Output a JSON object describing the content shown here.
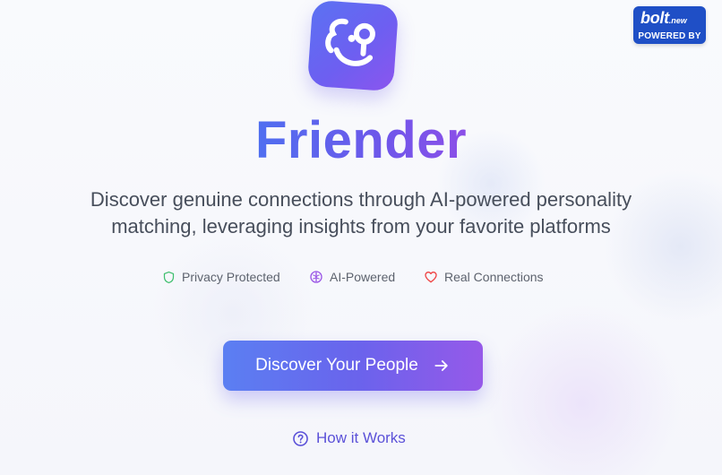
{
  "app": {
    "name": "Friender",
    "logo_icon": "smiley-face-logo-icon"
  },
  "hero": {
    "subtitle_line1": "Discover genuine connections through AI-powered personality",
    "subtitle_line2": "matching, leveraging insights from your favorite platforms"
  },
  "features": [
    {
      "label": "Privacy Protected",
      "icon": "shield-icon",
      "color": "#3fbf6e"
    },
    {
      "label": "AI-Powered",
      "icon": "brain-icon",
      "color": "#9a55e6"
    },
    {
      "label": "Real Connections",
      "icon": "heart-icon",
      "color": "#ef4444"
    }
  ],
  "cta": {
    "label": "Discover Your People",
    "icon": "arrow-right-icon"
  },
  "secondary_link": {
    "label": "How it Works",
    "icon": "help-circle-icon"
  },
  "powered_badge": {
    "brand": "bolt",
    "brand_suffix": ".new",
    "caption": "POWERED BY"
  },
  "colors": {
    "accent_blue": "#4f6ff0",
    "accent_purple": "#8c4fe8",
    "badge_bg": "#1f4fc6",
    "text_muted": "#474e5b"
  }
}
